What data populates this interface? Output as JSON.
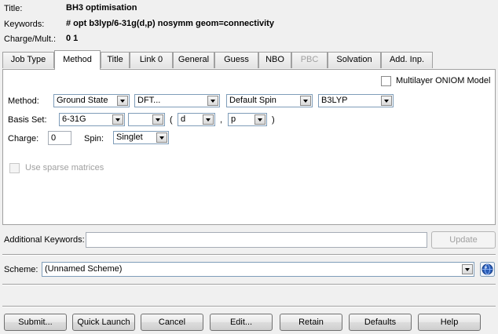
{
  "header": {
    "title_label": "Title:",
    "title_value": "BH3 optimisation",
    "keywords_label": "Keywords:",
    "keywords_value": "# opt b3lyp/6-31g(d,p) nosymm geom=connectivity",
    "charge_label": "Charge/Mult.:",
    "charge_value": "0 1"
  },
  "tabs": [
    {
      "label": "Job Type"
    },
    {
      "label": "Method",
      "active": true
    },
    {
      "label": "Title"
    },
    {
      "label": "Link 0"
    },
    {
      "label": "General"
    },
    {
      "label": "Guess"
    },
    {
      "label": "NBO"
    },
    {
      "label": "PBC",
      "disabled": true
    },
    {
      "label": "Solvation"
    },
    {
      "label": "Add. Inp."
    }
  ],
  "method_panel": {
    "oniom_label": "Multilayer ONIOM Model",
    "method_label": "Method:",
    "state_value": "Ground State",
    "type_value": "DFT...",
    "spin_type_value": "Default Spin",
    "functional_value": "B3LYP",
    "basis_label": "Basis Set:",
    "basis_value": "6-31G",
    "basis_extra_value": "",
    "open_paren": "(",
    "pol1_value": "d",
    "comma": ",",
    "pol2_value": "p",
    "close_paren": ")",
    "charge_label": "Charge:",
    "charge_value": "0",
    "spin_label": "Spin:",
    "spin_value": "Singlet",
    "sparse_label": "Use sparse matrices"
  },
  "additional": {
    "label": "Additional Keywords:",
    "value": "",
    "update_label": "Update"
  },
  "scheme": {
    "label": "Scheme:",
    "value": "(Unnamed Scheme)"
  },
  "buttons": {
    "submit": "Submit...",
    "quick_launch": "Quick Launch",
    "cancel": "Cancel",
    "edit": "Edit...",
    "retain": "Retain",
    "defaults": "Defaults",
    "help": "Help"
  },
  "icons": {
    "scheme_icon": "globe-settings-icon"
  }
}
